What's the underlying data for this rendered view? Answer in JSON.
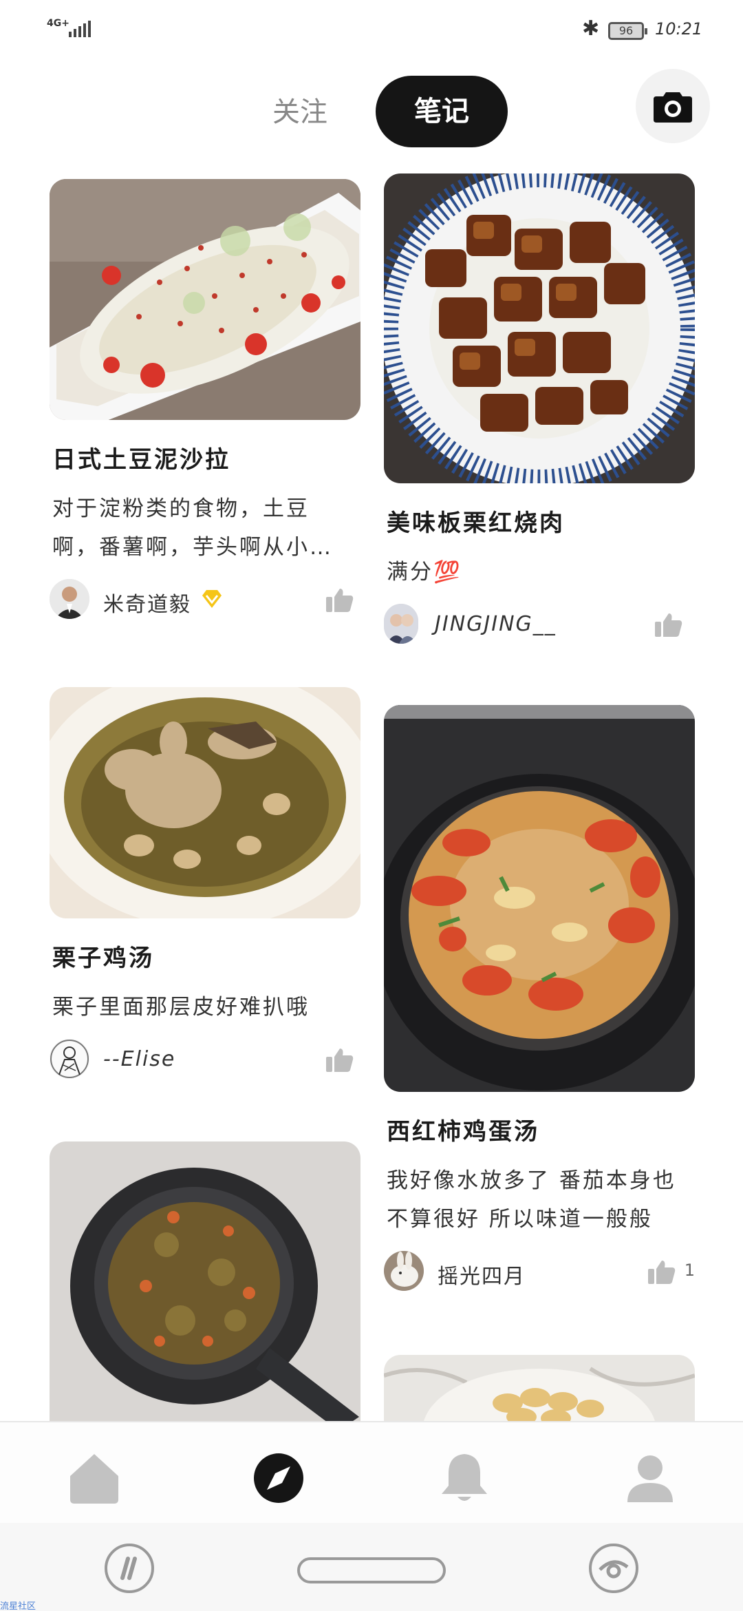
{
  "status_bar": {
    "network": "4G+",
    "battery": "96",
    "time": "10:21",
    "icons": [
      "signal-icon",
      "bluetooth-icon",
      "battery-icon"
    ]
  },
  "tabs": {
    "follow": "关注",
    "notes": "笔记",
    "active": "notes"
  },
  "cards": [
    {
      "title": "日式土豆泥沙拉",
      "desc_line1": "对于淀粉类的食物，土豆",
      "desc_line2": "啊，番薯啊，芋头啊从小…",
      "author": "米奇道毅",
      "author_badge": "diamond-badge-icon",
      "like_count": ""
    },
    {
      "title": "美味板栗红烧肉",
      "desc_line1": "满分💯",
      "author": "JINGJING__",
      "like_count": ""
    },
    {
      "title": "栗子鸡汤",
      "desc_line1": "栗子里面那层皮好难扒哦",
      "author": "--Elise",
      "like_count": ""
    },
    {
      "title": "西红柿鸡蛋汤",
      "desc_line1": "我好像水放多了 番茄本身也",
      "desc_line2": "不算很好 所以味道一般般",
      "author": "摇光四月",
      "like_count": "1"
    }
  ],
  "bottom_nav": {
    "items": [
      "home-icon",
      "discover-icon",
      "bell-icon",
      "profile-icon"
    ],
    "active": "discover-icon"
  },
  "colors": {
    "active_tab_bg": "#151515",
    "badge_gold": "#f5c518",
    "icon_gray": "#bdbdbd"
  },
  "watermark": "流星社区"
}
